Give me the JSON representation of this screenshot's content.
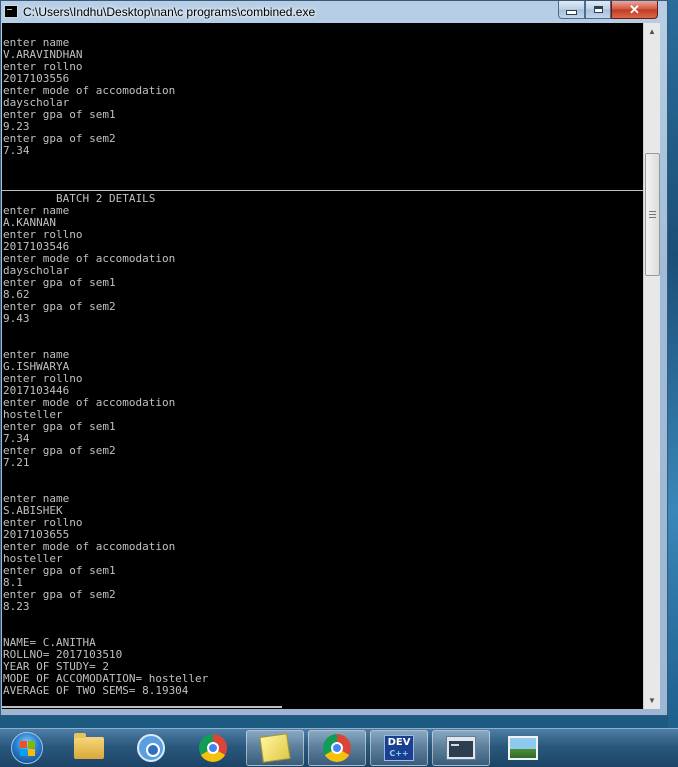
{
  "window": {
    "title": "C:\\Users\\Indhu\\Desktop\\nan\\c programs\\combined.exe",
    "controls": {
      "minimize": "minimize",
      "maximize": "maximize",
      "close": "✕"
    }
  },
  "console": {
    "lines": [
      "enter name",
      "V.ARAVINDHAN",
      "enter rollno",
      "2017103556",
      "enter mode of accomodation",
      "dayscholar",
      "enter gpa of sem1",
      "9.23",
      "enter gpa of sem2",
      "7.34",
      "",
      "",
      "",
      "        BATCH 2 DETAILS",
      "enter name",
      "A.KANNAN",
      "enter rollno",
      "2017103546",
      "enter mode of accomodation",
      "dayscholar",
      "enter gpa of sem1",
      "8.62",
      "enter gpa of sem2",
      "9.43",
      "",
      "",
      "enter name",
      "G.ISHWARYA",
      "enter rollno",
      "2017103446",
      "enter mode of accomodation",
      "hosteller",
      "enter gpa of sem1",
      "7.34",
      "enter gpa of sem2",
      "7.21",
      "",
      "",
      "enter name",
      "S.ABISHEK",
      "enter rollno",
      "2017103655",
      "enter mode of accomodation",
      "hosteller",
      "enter gpa of sem1",
      "8.1",
      "enter gpa of sem2",
      "8.23",
      "",
      "",
      "NAME= C.ANITHA",
      "ROLLNO= 2017103510",
      "YEAR OF STUDY= 2",
      "MODE OF ACCOMODATION= hosteller",
      "AVERAGE OF TWO SEMS= 8.19304"
    ]
  },
  "scrollbar": {
    "up_arrow": "▲",
    "down_arrow": "▼"
  },
  "taskbar": {
    "items": [
      {
        "name": "start-button",
        "icon": "windows-orb-icon"
      },
      {
        "name": "file-explorer",
        "icon": "folder-icon"
      },
      {
        "name": "chromium",
        "icon": "chromium-icon"
      },
      {
        "name": "chrome",
        "icon": "chrome-icon"
      },
      {
        "name": "sticky-notes",
        "icon": "sticky-notes-icon"
      },
      {
        "name": "chrome-profile",
        "icon": "chrome-icon"
      },
      {
        "name": "dev-cpp",
        "icon": "devcpp-icon",
        "label_top": "DEV",
        "label_bottom": "C++"
      },
      {
        "name": "console-window",
        "icon": "console-window-icon",
        "active": true
      },
      {
        "name": "picture-viewer",
        "icon": "picture-icon"
      }
    ]
  }
}
